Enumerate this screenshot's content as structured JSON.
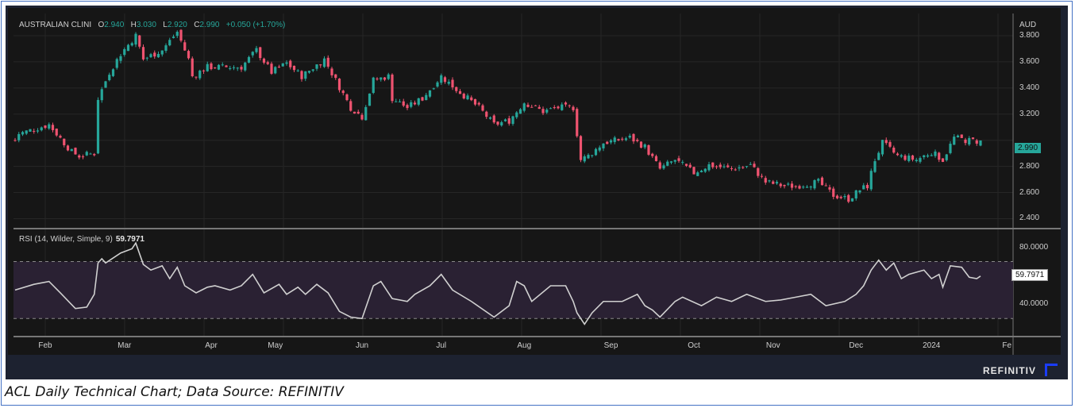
{
  "chart_data": [
    {
      "type": "candlestick",
      "title": "AUSTRALIAN CLINI",
      "ohlc_readout": {
        "open_label": "O",
        "open": "2.940",
        "high_label": "H",
        "high": "3.030",
        "low_label": "L",
        "low": "2.920",
        "close_label": "C",
        "close": "2.990",
        "change": "+0.050 (+1.70%)"
      },
      "currency": "AUD",
      "y_ticks": [
        "3.800",
        "3.600",
        "3.400",
        "3.200",
        "2.800",
        "2.600",
        "2.400"
      ],
      "ylim": [
        2.33,
        3.97
      ],
      "last_price_tag": "2.990",
      "close_waypoints_by_trading_day": [
        [
          0,
          3.0
        ],
        [
          1,
          3.05
        ],
        [
          9,
          3.12
        ],
        [
          15,
          2.91
        ],
        [
          17,
          2.88
        ],
        [
          21,
          2.9
        ],
        [
          22,
          3.32
        ],
        [
          25,
          3.52
        ],
        [
          28,
          3.66
        ],
        [
          32,
          3.8
        ],
        [
          34,
          3.62
        ],
        [
          39,
          3.69
        ],
        [
          43,
          3.83
        ],
        [
          46,
          3.62
        ],
        [
          47,
          3.49
        ],
        [
          51,
          3.56
        ],
        [
          60,
          3.56
        ],
        [
          64,
          3.69
        ],
        [
          68,
          3.52
        ],
        [
          72,
          3.59
        ],
        [
          76,
          3.49
        ],
        [
          82,
          3.62
        ],
        [
          85,
          3.46
        ],
        [
          89,
          3.25
        ],
        [
          92,
          3.18
        ],
        [
          95,
          3.46
        ],
        [
          99,
          3.49
        ],
        [
          100,
          3.32
        ],
        [
          104,
          3.25
        ],
        [
          108,
          3.32
        ],
        [
          113,
          3.49
        ],
        [
          117,
          3.39
        ],
        [
          123,
          3.25
        ],
        [
          127,
          3.12
        ],
        [
          131,
          3.15
        ],
        [
          135,
          3.29
        ],
        [
          140,
          3.22
        ],
        [
          144,
          3.25
        ],
        [
          148,
          3.25
        ],
        [
          150,
          2.85
        ],
        [
          152,
          2.88
        ],
        [
          156,
          2.98
        ],
        [
          163,
          3.02
        ],
        [
          167,
          2.95
        ],
        [
          171,
          2.78
        ],
        [
          175,
          2.85
        ],
        [
          180,
          2.75
        ],
        [
          184,
          2.81
        ],
        [
          190,
          2.78
        ],
        [
          195,
          2.81
        ],
        [
          199,
          2.68
        ],
        [
          204,
          2.65
        ],
        [
          207,
          2.65
        ],
        [
          213,
          2.68
        ],
        [
          217,
          2.58
        ],
        [
          221,
          2.55
        ],
        [
          224,
          2.62
        ],
        [
          226,
          2.65
        ],
        [
          228,
          2.85
        ],
        [
          230,
          2.98
        ],
        [
          234,
          2.88
        ],
        [
          239,
          2.85
        ],
        [
          243,
          2.91
        ],
        [
          246,
          2.85
        ],
        [
          249,
          3.02
        ],
        [
          252,
          3.0
        ],
        [
          256,
          2.99
        ]
      ],
      "colors": {
        "up": "#26a69a",
        "down": "#ef5370"
      }
    },
    {
      "type": "line",
      "title": "RSI (14, Wilder, Simple, 9)",
      "last_value": "59.7971",
      "y_ticks": [
        "80.0000",
        "40.0000"
      ],
      "ylim": [
        14,
        92
      ],
      "bands": [
        30,
        70
      ],
      "values_by_trading_day": [
        [
          0,
          50
        ],
        [
          5,
          54
        ],
        [
          9,
          56
        ],
        [
          12,
          48
        ],
        [
          16,
          37
        ],
        [
          19,
          38
        ],
        [
          21,
          47
        ],
        [
          22,
          69
        ],
        [
          23,
          72
        ],
        [
          24,
          69
        ],
        [
          28,
          76
        ],
        [
          31,
          79
        ],
        [
          32,
          83
        ],
        [
          34,
          68
        ],
        [
          36,
          64
        ],
        [
          39,
          67
        ],
        [
          41,
          58
        ],
        [
          43,
          66
        ],
        [
          45,
          53
        ],
        [
          48,
          48
        ],
        [
          51,
          52
        ],
        [
          53,
          53
        ],
        [
          57,
          50
        ],
        [
          60,
          53
        ],
        [
          63,
          61
        ],
        [
          66,
          48
        ],
        [
          70,
          54
        ],
        [
          72,
          47
        ],
        [
          75,
          52
        ],
        [
          77,
          47
        ],
        [
          80,
          54
        ],
        [
          83,
          48
        ],
        [
          86,
          35
        ],
        [
          89,
          31
        ],
        [
          92,
          30
        ],
        [
          95,
          53
        ],
        [
          97,
          56
        ],
        [
          100,
          44
        ],
        [
          104,
          42
        ],
        [
          106,
          47
        ],
        [
          110,
          53
        ],
        [
          113,
          61
        ],
        [
          116,
          50
        ],
        [
          121,
          42
        ],
        [
          127,
          31
        ],
        [
          131,
          39
        ],
        [
          133,
          56
        ],
        [
          135,
          53
        ],
        [
          137,
          42
        ],
        [
          142,
          53
        ],
        [
          146,
          53
        ],
        [
          148,
          42
        ],
        [
          149,
          34
        ],
        [
          151,
          26
        ],
        [
          153,
          34
        ],
        [
          156,
          42
        ],
        [
          161,
          42
        ],
        [
          165,
          47
        ],
        [
          167,
          39
        ],
        [
          169,
          36
        ],
        [
          171,
          31
        ],
        [
          175,
          42
        ],
        [
          177,
          45
        ],
        [
          182,
          39
        ],
        [
          186,
          45
        ],
        [
          190,
          42
        ],
        [
          194,
          47
        ],
        [
          199,
          42
        ],
        [
          203,
          43
        ],
        [
          207,
          45
        ],
        [
          211,
          47
        ],
        [
          215,
          39
        ],
        [
          220,
          42
        ],
        [
          223,
          47
        ],
        [
          225,
          53
        ],
        [
          227,
          64
        ],
        [
          229,
          71
        ],
        [
          231,
          64
        ],
        [
          233,
          69
        ],
        [
          235,
          58
        ],
        [
          237,
          61
        ],
        [
          241,
          64
        ],
        [
          243,
          58
        ],
        [
          245,
          61
        ],
        [
          246,
          52
        ],
        [
          248,
          67
        ],
        [
          251,
          66
        ],
        [
          253,
          59
        ],
        [
          255,
          58
        ],
        [
          256,
          59.8
        ]
      ],
      "x_ticks": [
        [
          "Feb",
          8
        ],
        [
          "Mar",
          29
        ],
        [
          "Apr",
          52
        ],
        [
          "May",
          69
        ],
        [
          "Jun",
          92
        ],
        [
          "Jul",
          113
        ],
        [
          "Aug",
          135
        ],
        [
          "Sep",
          158
        ],
        [
          "Oct",
          180
        ],
        [
          "Nov",
          201
        ],
        [
          "Dec",
          223
        ],
        [
          "2024",
          243
        ],
        [
          "Fe",
          263
        ]
      ]
    }
  ],
  "brand": "REFINITIV",
  "caption": "ACL Daily Technical Chart; Data Source: REFINITIV"
}
